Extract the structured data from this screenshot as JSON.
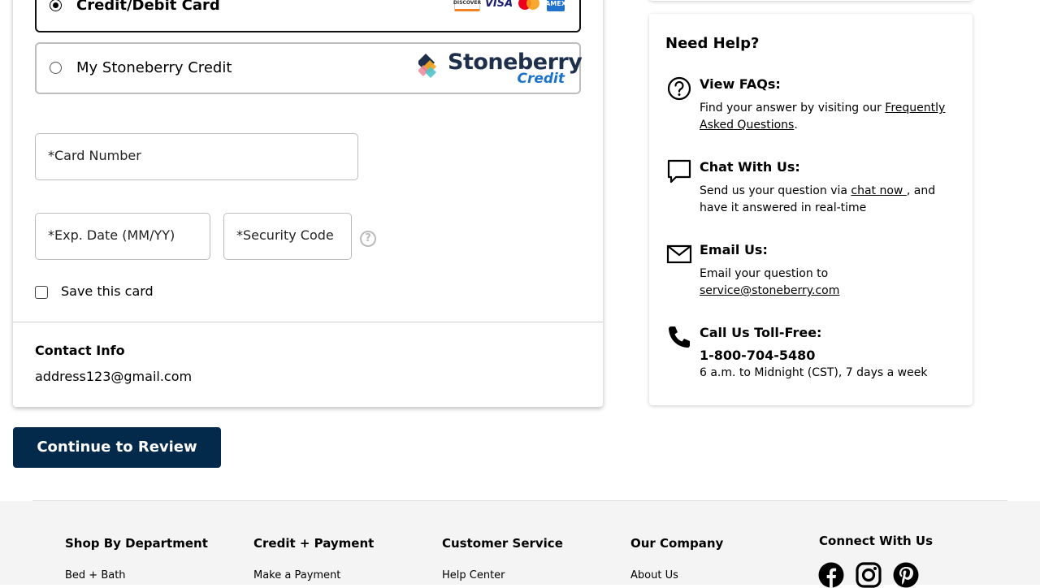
{
  "payment": {
    "options": {
      "credit_debit": {
        "label": "Credit/Debit Card",
        "selected": true,
        "card_brands": [
          "DISCOVER",
          "VISA",
          "mastercard",
          "AMEX"
        ]
      },
      "stoneberry": {
        "label": "My Stoneberry Credit",
        "selected": false,
        "logo_word": "Stoneberry",
        "logo_sub": "Credit"
      }
    },
    "fields": {
      "card_number": "*Card Number",
      "exp_date": "*Exp. Date (MM/YY)",
      "security_code": "*Security Code"
    },
    "help_glyph": "?",
    "save_card_label": "Save this card",
    "save_card_checked": false
  },
  "contact": {
    "title": "Contact Info",
    "email": "address123@gmail.com"
  },
  "continue_button": "Continue to Review",
  "help": {
    "title": "Need Help?",
    "faq": {
      "title": "View FAQs:",
      "text_before": "Find your answer by visiting our ",
      "link": "Frequently Asked Questions",
      "text_after": ".",
      "icon": "question-circle-icon"
    },
    "chat": {
      "title": "Chat With Us:",
      "text_before": "Send us your question via ",
      "link": "chat now ",
      "text_after": ", and have it answered in real-time",
      "icon": "chat-bubble-icon"
    },
    "email": {
      "title": "Email Us:",
      "text_before": "Email your question to ",
      "link": "service@stoneberry.com",
      "icon": "envelope-icon"
    },
    "call": {
      "title": "Call Us Toll-Free:",
      "phone": "1-800-704-5480",
      "hours": "6 a.m. to Midnight (CST), 7 days a week",
      "icon": "phone-icon"
    }
  },
  "footer": {
    "columns": [
      {
        "heading": "Shop By Department",
        "first_link": "Bed + Bath"
      },
      {
        "heading": "Credit + Payment",
        "first_link": "Make a Payment"
      },
      {
        "heading": "Customer Service",
        "first_link": "Help Center"
      },
      {
        "heading": "Our Company",
        "first_link": "About Us"
      }
    ],
    "connect": {
      "heading": "Connect With Us",
      "icons": [
        "facebook-icon",
        "instagram-icon",
        "pinterest-icon"
      ]
    }
  },
  "colors": {
    "primary_button": "#032a4b",
    "stoneberry_navy": "#1d2f4a",
    "stoneberry_blue": "#1a73c9",
    "footer_bg": "#f4f4f4"
  }
}
